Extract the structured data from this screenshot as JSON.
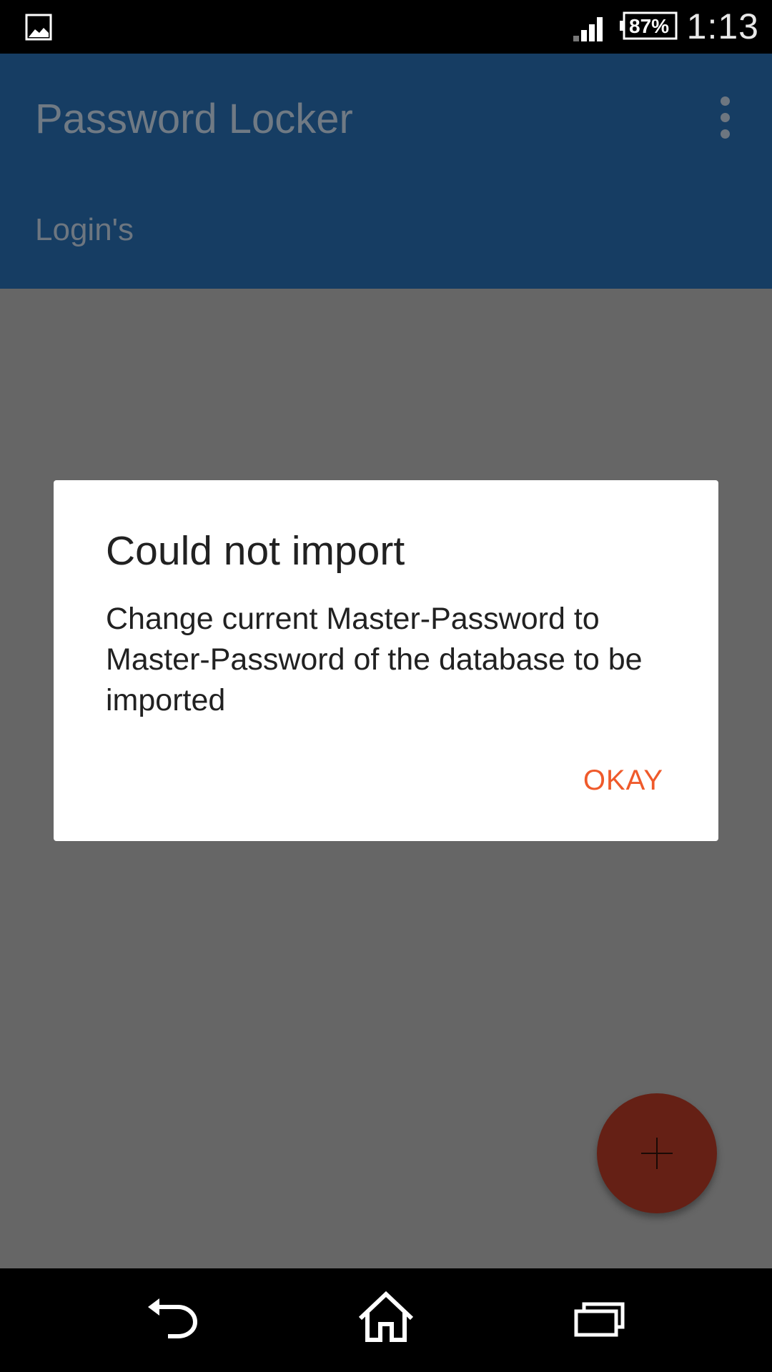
{
  "status_bar": {
    "battery_percent": "87%",
    "time": "1:13",
    "icons": [
      "image-icon",
      "signal-icon",
      "battery-icon"
    ]
  },
  "app_bar": {
    "title": "Password Locker",
    "tab_label": "Login's",
    "color": "#163d63"
  },
  "dialog": {
    "title": "Could not import",
    "message": "Change current Master-Password to Master-Password of the database to be imported",
    "okay_label": "OKAY",
    "accent_color": "#ef5a2b"
  },
  "fab": {
    "icon": "plus-icon",
    "color": "#652015"
  },
  "nav_bar": {
    "icons": [
      "back-icon",
      "home-icon",
      "recents-icon"
    ]
  }
}
